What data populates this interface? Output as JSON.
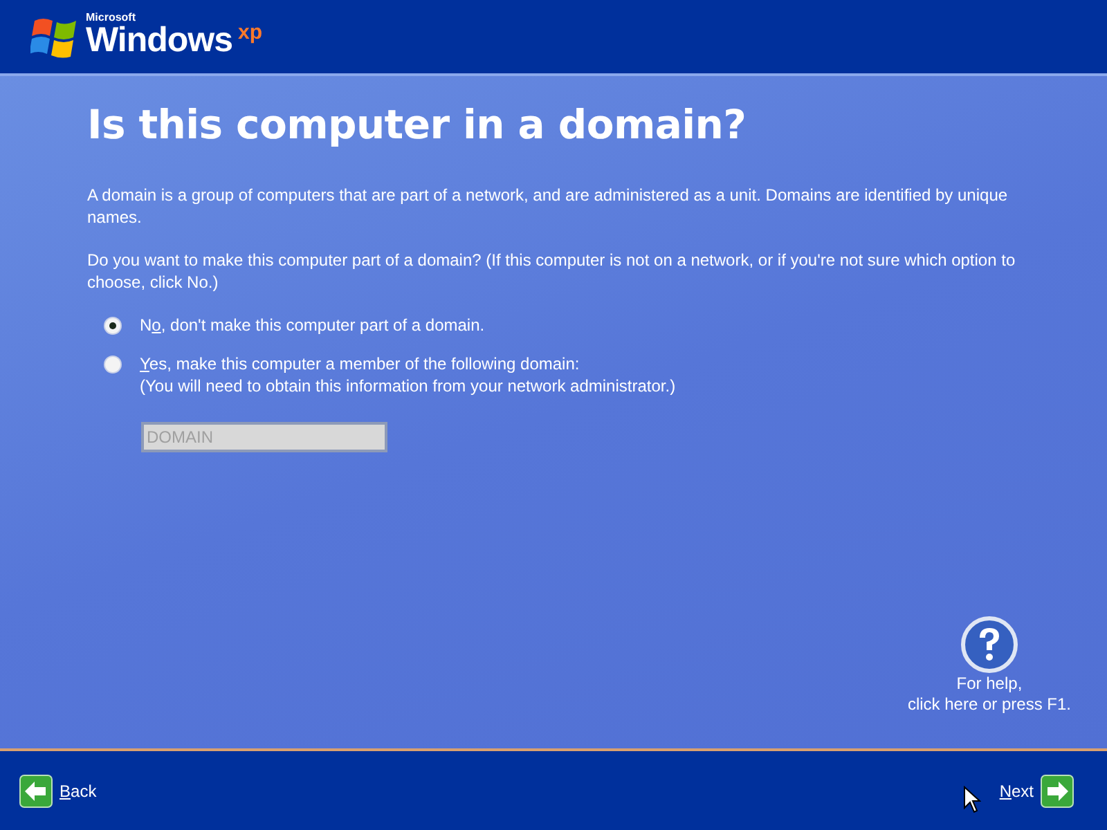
{
  "logo": {
    "company": "Microsoft",
    "product": "Windows",
    "edition": "xp"
  },
  "title": "Is this computer in a domain?",
  "paragraphs": [
    "A domain is a group of computers that are part of a network, and are administered as a unit. Domains are identified by unique names.",
    "Do you want to make this computer part of a domain? (If this computer is not on a network, or if you're not sure which option to choose, click No.)"
  ],
  "options": [
    {
      "before": "N",
      "key": "o",
      "after": ", don't make this computer part of a domain.",
      "selected": true
    },
    {
      "key": "Y",
      "after": "es, make this computer a member of the following domain:",
      "note": "(You will need to obtain this information from your network administrator.)",
      "selected": false
    }
  ],
  "domain_field": {
    "value": "DOMAIN",
    "disabled": true
  },
  "help": {
    "lines": [
      "For help,",
      "click here or press F1."
    ]
  },
  "back": {
    "key": "B",
    "rest": "ack"
  },
  "next": {
    "key": "N",
    "rest": "ext"
  }
}
